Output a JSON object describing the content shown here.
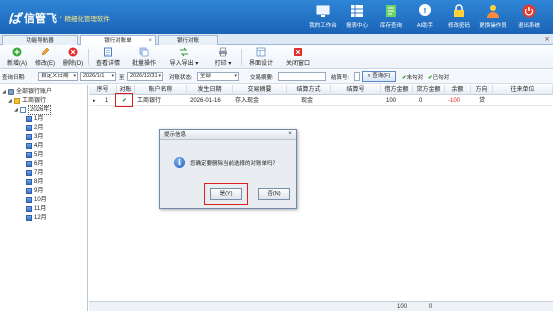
{
  "app": {
    "logo_mark": "ば",
    "name": "信管飞",
    "dot": "·",
    "slogan": "精细化管理软件"
  },
  "header_buttons": [
    {
      "name": "my-workbench",
      "label": "我的工作台",
      "icon": "monitor-icon"
    },
    {
      "name": "report-center",
      "label": "报表中心",
      "icon": "table-icon"
    },
    {
      "name": "stock-query",
      "label": "库存查询",
      "icon": "document-icon"
    },
    {
      "name": "ai-assistant",
      "label": "AI助手",
      "icon": "ai-bubble-icon"
    },
    {
      "name": "change-password",
      "label": "修改密码",
      "icon": "lock-icon"
    },
    {
      "name": "switch-operator",
      "label": "更换操作员",
      "icon": "user-icon"
    },
    {
      "name": "exit-system",
      "label": "退出系统",
      "icon": "power-icon"
    }
  ],
  "tabs": [
    {
      "label": "功能导航器"
    },
    {
      "label": "银行对账单"
    },
    {
      "label": "银行对账"
    }
  ],
  "toolbar": {
    "new": "新增(A)",
    "edit": "修改(E)",
    "delete": "删除(D)",
    "view": "查看详情",
    "batch": "批量操作",
    "import_export": "导入导出",
    "print": "打印",
    "layout": "界面设计",
    "close": "关闭窗口",
    "dropdown_arrow": "▾"
  },
  "filters": {
    "date_label": "查询日期:",
    "date_range_value": "自定义日期",
    "date_from": "2026/1/1",
    "date_to_label": "至",
    "date_to": "2026/12/31",
    "status_label": "对账状态:",
    "status_value": "全部",
    "summary_label": "交易摘要:",
    "summary_value": "",
    "account_label": "结算号:",
    "account_value": "",
    "query_button": "查询(F)",
    "unchecked_label": "未勾对",
    "checked_label": "已勾对",
    "check_mark": "✔"
  },
  "tree": {
    "root": "全部银行账户",
    "bank": "工商银行",
    "year": "2026年",
    "months": [
      "1月",
      "2月",
      "3月",
      "4月",
      "5月",
      "6月",
      "7月",
      "8月",
      "9月",
      "10月",
      "11月",
      "12月"
    ]
  },
  "grid": {
    "columns": [
      "序号",
      "对账",
      "账户名称",
      "发生日期",
      "交易摘要",
      "结算方式",
      "结算号",
      "借方金额",
      "贷方金额",
      "余额",
      "方向",
      "往来单位"
    ],
    "rows": [
      {
        "marker": "▸",
        "no": "1",
        "check": "✔",
        "account": "工商银行",
        "date": "2026-01-16",
        "summary": "存入现金",
        "method": "现金",
        "ref": "",
        "debit": "100",
        "credit": "0",
        "balance": "-100",
        "direction": "贷",
        "party": ""
      }
    ],
    "footer": {
      "debit_total": "100",
      "credit_total": "0"
    }
  },
  "dialog": {
    "title": "提示信息",
    "close": "×",
    "icon_glyph": "i",
    "message": "您确定要删除当前选择的对账单吗？",
    "yes": "是(Y)",
    "no": "否(N)"
  },
  "colors": {
    "header": "#1f6ec2",
    "highlight": "#e02020",
    "negative": "#e02020"
  }
}
